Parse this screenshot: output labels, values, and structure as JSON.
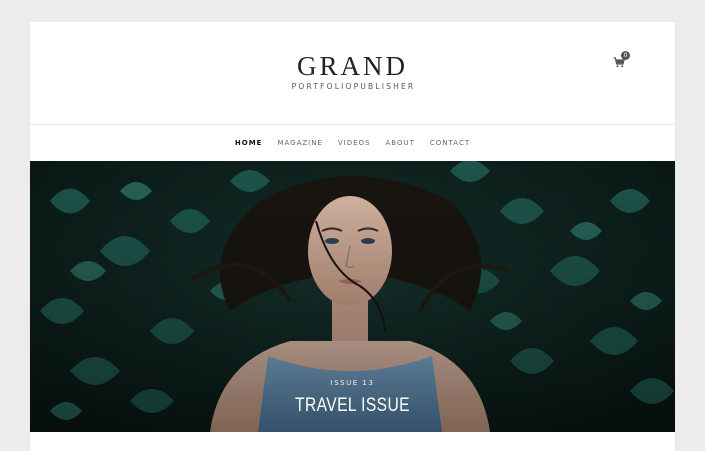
{
  "brand": {
    "title": "GRAND",
    "subtitle": "PORTFOLIOPUBLISHER"
  },
  "cart": {
    "icon": "cart-icon",
    "count": "0"
  },
  "nav": {
    "items": [
      {
        "label": "HOME",
        "active": true
      },
      {
        "label": "MAGAZINE",
        "active": false
      },
      {
        "label": "VIDEOS",
        "active": false
      },
      {
        "label": "ABOUT",
        "active": false
      },
      {
        "label": "CONTACT",
        "active": false
      }
    ]
  },
  "hero": {
    "kicker": "ISSUE 13",
    "title": "TRAVEL ISSUE"
  },
  "colors": {
    "page_bg": "#ececec",
    "card_bg": "#ffffff",
    "text_dark": "#222222",
    "leaf_dark": "#0f2420",
    "leaf_teal": "#1f5a4f",
    "dress_blue": "#5f8eb4"
  }
}
